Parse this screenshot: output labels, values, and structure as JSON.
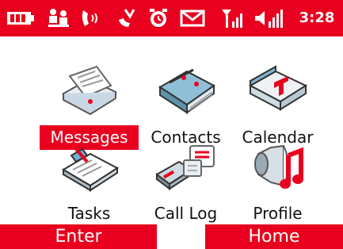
{
  "status_bar": {
    "time": "3:28",
    "icons": [
      "battery-icon",
      "people-icon",
      "voicemail-icon",
      "missed-call-icon",
      "alarm-icon",
      "message-icon",
      "signal-icon",
      "volume-icon"
    ]
  },
  "apps": [
    {
      "label": "Messages",
      "icon": "envelope-icon",
      "selected": true
    },
    {
      "label": "Contacts",
      "icon": "address-book-icon",
      "selected": false
    },
    {
      "label": "Calendar",
      "icon": "calendar-icon",
      "selected": false
    },
    {
      "label": "Tasks",
      "icon": "clipboard-icon",
      "selected": false
    },
    {
      "label": "Call Log",
      "icon": "phone-log-icon",
      "selected": false
    },
    {
      "label": "Profile",
      "icon": "speaker-music-icon",
      "selected": false
    }
  ],
  "softkeys": {
    "left": "Enter",
    "right": "Home"
  },
  "colors": {
    "accent": "#e8001e",
    "background": "#ffffff",
    "text": "#111111"
  }
}
